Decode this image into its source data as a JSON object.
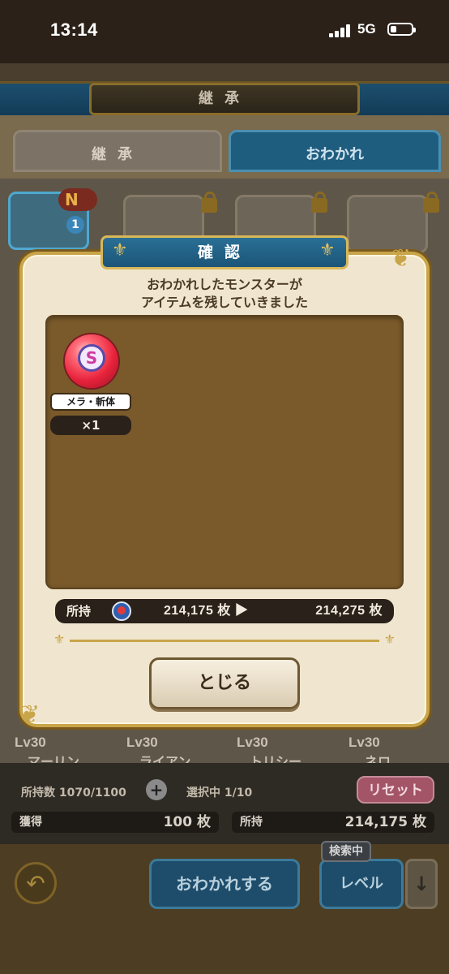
{
  "status_bar": {
    "time": "13:14",
    "network": "5G"
  },
  "screen": {
    "title": "継承",
    "tabs": [
      {
        "label": "継承"
      },
      {
        "label": "おわかれ"
      }
    ],
    "selected_badge": {
      "letter": "N",
      "count": "1"
    },
    "monsters_bottom_row": [
      {
        "level": "Lv30",
        "name": "マーリン"
      },
      {
        "level": "Lv30",
        "name": "ライアン"
      },
      {
        "level": "Lv30",
        "name": "トリシー"
      },
      {
        "level": "Lv30",
        "name": "ネロ"
      }
    ],
    "holdings_label": "所持数",
    "holdings_value": "1070/1100",
    "selecting_label": "選択中",
    "selecting_value": "1/10",
    "reset_label": "リセット",
    "gain_label": "獲得",
    "gain_value": "100 枚",
    "own_label": "所持",
    "own_value": "214,175 枚",
    "owakare_button": "おわかれする",
    "search_tag": "検索中",
    "sort_button": "レベル"
  },
  "dialog": {
    "title": "確認",
    "message_line1": "おわかれしたモンスターが",
    "message_line2": "アイテムを残していきました",
    "item": {
      "icon_letter": "S",
      "name": "メラ・斬体",
      "count": "×1"
    },
    "own_label": "所持",
    "own_from": "214,175 枚",
    "own_to": "214,275 枚",
    "close_button": "とじる"
  },
  "colors": {
    "dialog_bg": "#f0e6cf",
    "dialog_border": "#c9a54a",
    "title_plate": "#1b5578",
    "items_box": "#7a5a2a"
  }
}
